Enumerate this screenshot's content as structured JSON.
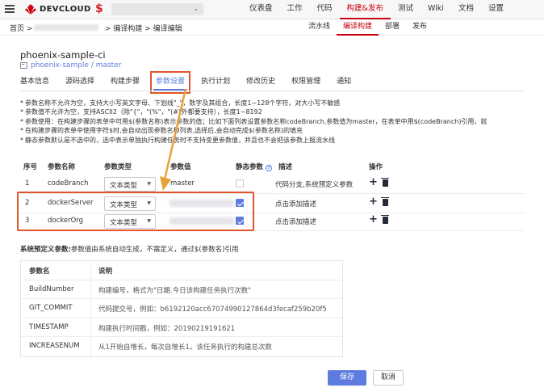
{
  "brand": {
    "name": "DEVCLOUD",
    "accent": "#c7000b"
  },
  "project_icon": "$",
  "top_nav": [
    "仪表盘",
    "工作",
    "代码",
    "构建&发布",
    "测试",
    "Wiki",
    "文档",
    "设置"
  ],
  "top_nav_active": 3,
  "breadcrumb": {
    "home": "首页 >",
    "rest": "> 编译构建 > 编译编辑"
  },
  "sub_nav": [
    "流水线",
    "编译构建",
    "部署",
    "发布"
  ],
  "sub_nav_active": 1,
  "page": {
    "title": "phoenix-sample-ci",
    "repo": "phoenix-sample / master"
  },
  "tabs": [
    "基本信息",
    "源码选择",
    "构建步骤",
    "参数设置",
    "执行计划",
    "修改历史",
    "权限管理",
    "通知"
  ],
  "tab_active": 3,
  "notes": [
    "参数名称不允许为空，支持大小写英文字母、下划线\"_\"，数字及其组合，长度1~128个字符，对大小写不敏感",
    "参数值不允许为空，支持ASCII2（除\"{\"，\"(%\"，\"(#\"外都要支持），长度1~8192",
    "参数使用：在构建步骤的表单中可用$(参数名称)表示参数的值；比如下面列表设置参数名称codeBranch,参数值为master，在表单中用$(codeBranch)引用，就",
    "在构建步骤的表单中使用字符$时,会自动出现参数名称列表,选择后,会自动完成$(参数名称)的填充",
    "静态参数默认是不选中的，选中表示单独执行构建任务时不支持变更参数值，并且也不会把该参数上报流水线"
  ],
  "param_table": {
    "headers": {
      "index": "序号",
      "name": "参数名称",
      "type": "参数类型",
      "value": "参数值",
      "static": "静态参数",
      "desc": "描述",
      "ops": "操作"
    },
    "rows": [
      {
        "index": "1",
        "name": "codeBranch",
        "type": "文本类型",
        "value": "master",
        "static": false,
        "desc": "代码分支,系统预定义参数"
      },
      {
        "index": "2",
        "name": "dockerServer",
        "type": "文本类型",
        "value": "",
        "static": true,
        "desc": "点击添加描述"
      },
      {
        "index": "3",
        "name": "dockerOrg",
        "type": "文本类型",
        "value": "",
        "static": true,
        "desc": "点击添加描述"
      }
    ]
  },
  "system_params": {
    "title_bold": "系统预定义参数:",
    "title_rest": "参数值由系统自动生成，不需定义，通过$(参数名)引用",
    "headers": [
      "参数名",
      "说明"
    ],
    "rows": [
      [
        "BuildNumber",
        "构建编号，格式为\"日期.今日该构建任务执行次数\""
      ],
      [
        "GIT_COMMIT",
        "代码提交号，例如：b6192120acc67074990127864d3fecaf259b20f5"
      ],
      [
        "TIMESTAMP",
        "构建执行时间戳，例如：20190219191621"
      ],
      [
        "INCREASENUM",
        "从1开始自增长，每次自增长1。该任务执行的构建总次数"
      ]
    ]
  },
  "buttons": {
    "save": "保存",
    "cancel": "取消"
  },
  "colors": {
    "primary": "#5e7ce0",
    "annotation": "#e0542a",
    "annotation_arrow": "#e8a13a"
  }
}
